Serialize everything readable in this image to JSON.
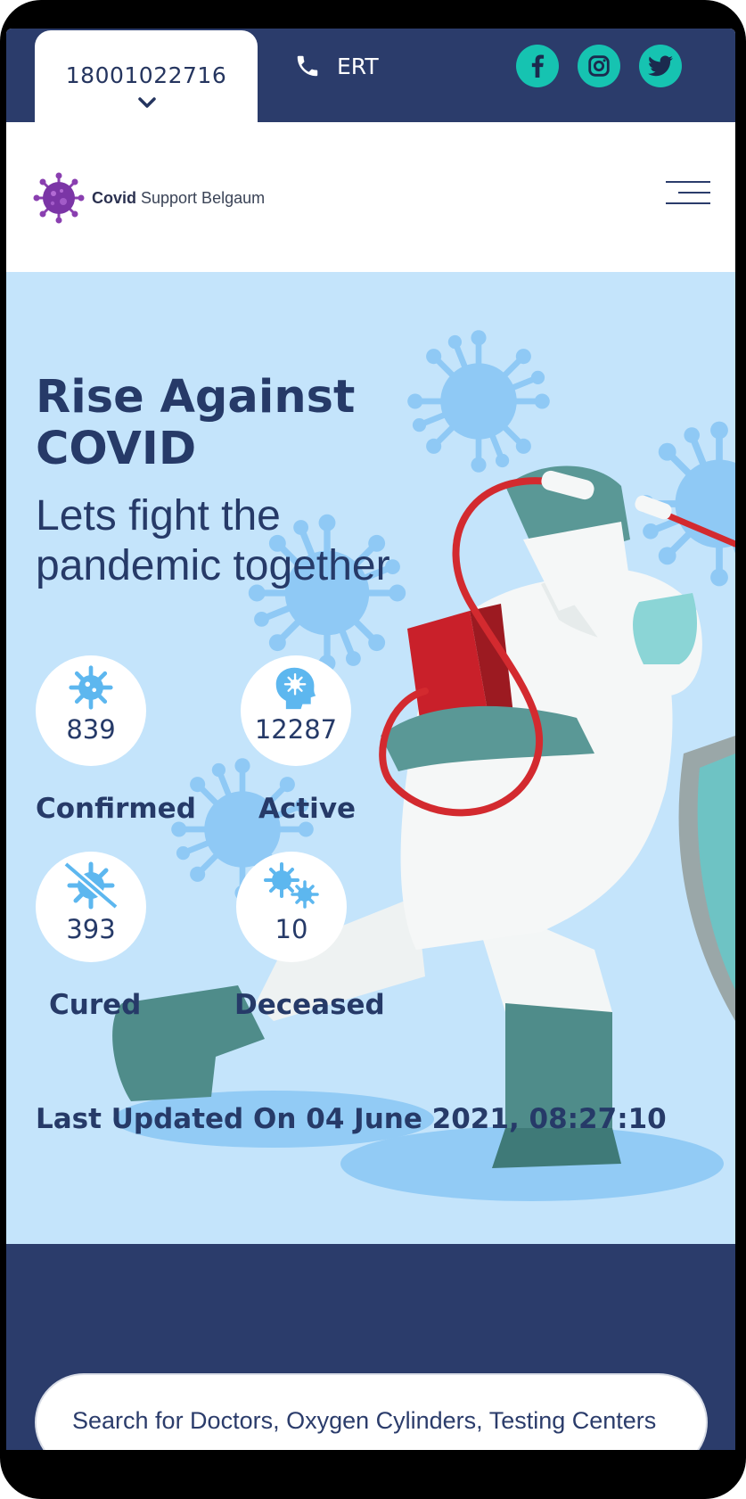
{
  "topbar": {
    "phone_number": "18001022716",
    "ert_label": "ERT",
    "social": [
      "facebook-icon",
      "instagram-icon",
      "twitter-icon"
    ]
  },
  "header": {
    "brand_bold": "Covid",
    "brand_rest": " Support Belgaum"
  },
  "hero": {
    "title_line1": "Rise Against",
    "title_line2": "COVID",
    "subtitle_line1": "Lets fight the",
    "subtitle_line2": "pandemic together",
    "stats": {
      "confirmed": {
        "value": "839",
        "label": "Confirmed"
      },
      "active": {
        "value": "12287",
        "label": "Active"
      },
      "cured": {
        "value": "393",
        "label": "Cured"
      },
      "deceased": {
        "value": "10",
        "label": "Deceased"
      }
    },
    "last_updated": "Last Updated On 04 June 2021, 08:27:10"
  },
  "search": {
    "placeholder": "Search for Doctors, Oxygen Cylinders, Testing Centers"
  },
  "colors": {
    "navy": "#2b3c6b",
    "teal": "#16c3b1",
    "hero_bg": "#c4e4fb",
    "icon_blue": "#5db7ef"
  }
}
